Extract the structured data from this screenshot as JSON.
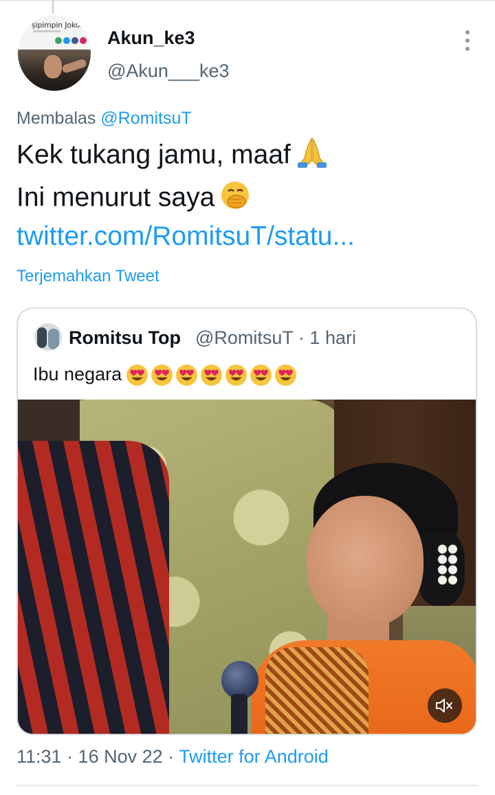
{
  "user": {
    "name": "Akun_ke3",
    "handle": "@Akun___ke3",
    "avatar_caption": "șipimpin Joko..."
  },
  "reply": {
    "prefix": "Membalas",
    "mention": "@RomitsuT"
  },
  "tweet": {
    "line1": "Kek tukang jamu, maaf",
    "line2": "Ini menurut saya",
    "link": "twitter.com/RomitsuT/statu...",
    "emoji1": "folded-hands",
    "emoji2": "face-with-hand-over-mouth"
  },
  "translate_label": "Terjemahkan Tweet",
  "quote": {
    "name": "Romitsu Top",
    "handle": "@RomitsuT · 1 hari",
    "text": "Ibu negara",
    "emoji": "heart-eyes",
    "emoji_count": 7
  },
  "video": {
    "mute_icon": "speaker-muted-icon"
  },
  "meta": {
    "time": "11:31 · 16 Nov 22 · ",
    "source": "Twitter for Android"
  },
  "colors": {
    "link": "#1d9bf0",
    "secondary_text": "#536471",
    "primary_text": "#0f1419",
    "border": "#d7dde1"
  }
}
